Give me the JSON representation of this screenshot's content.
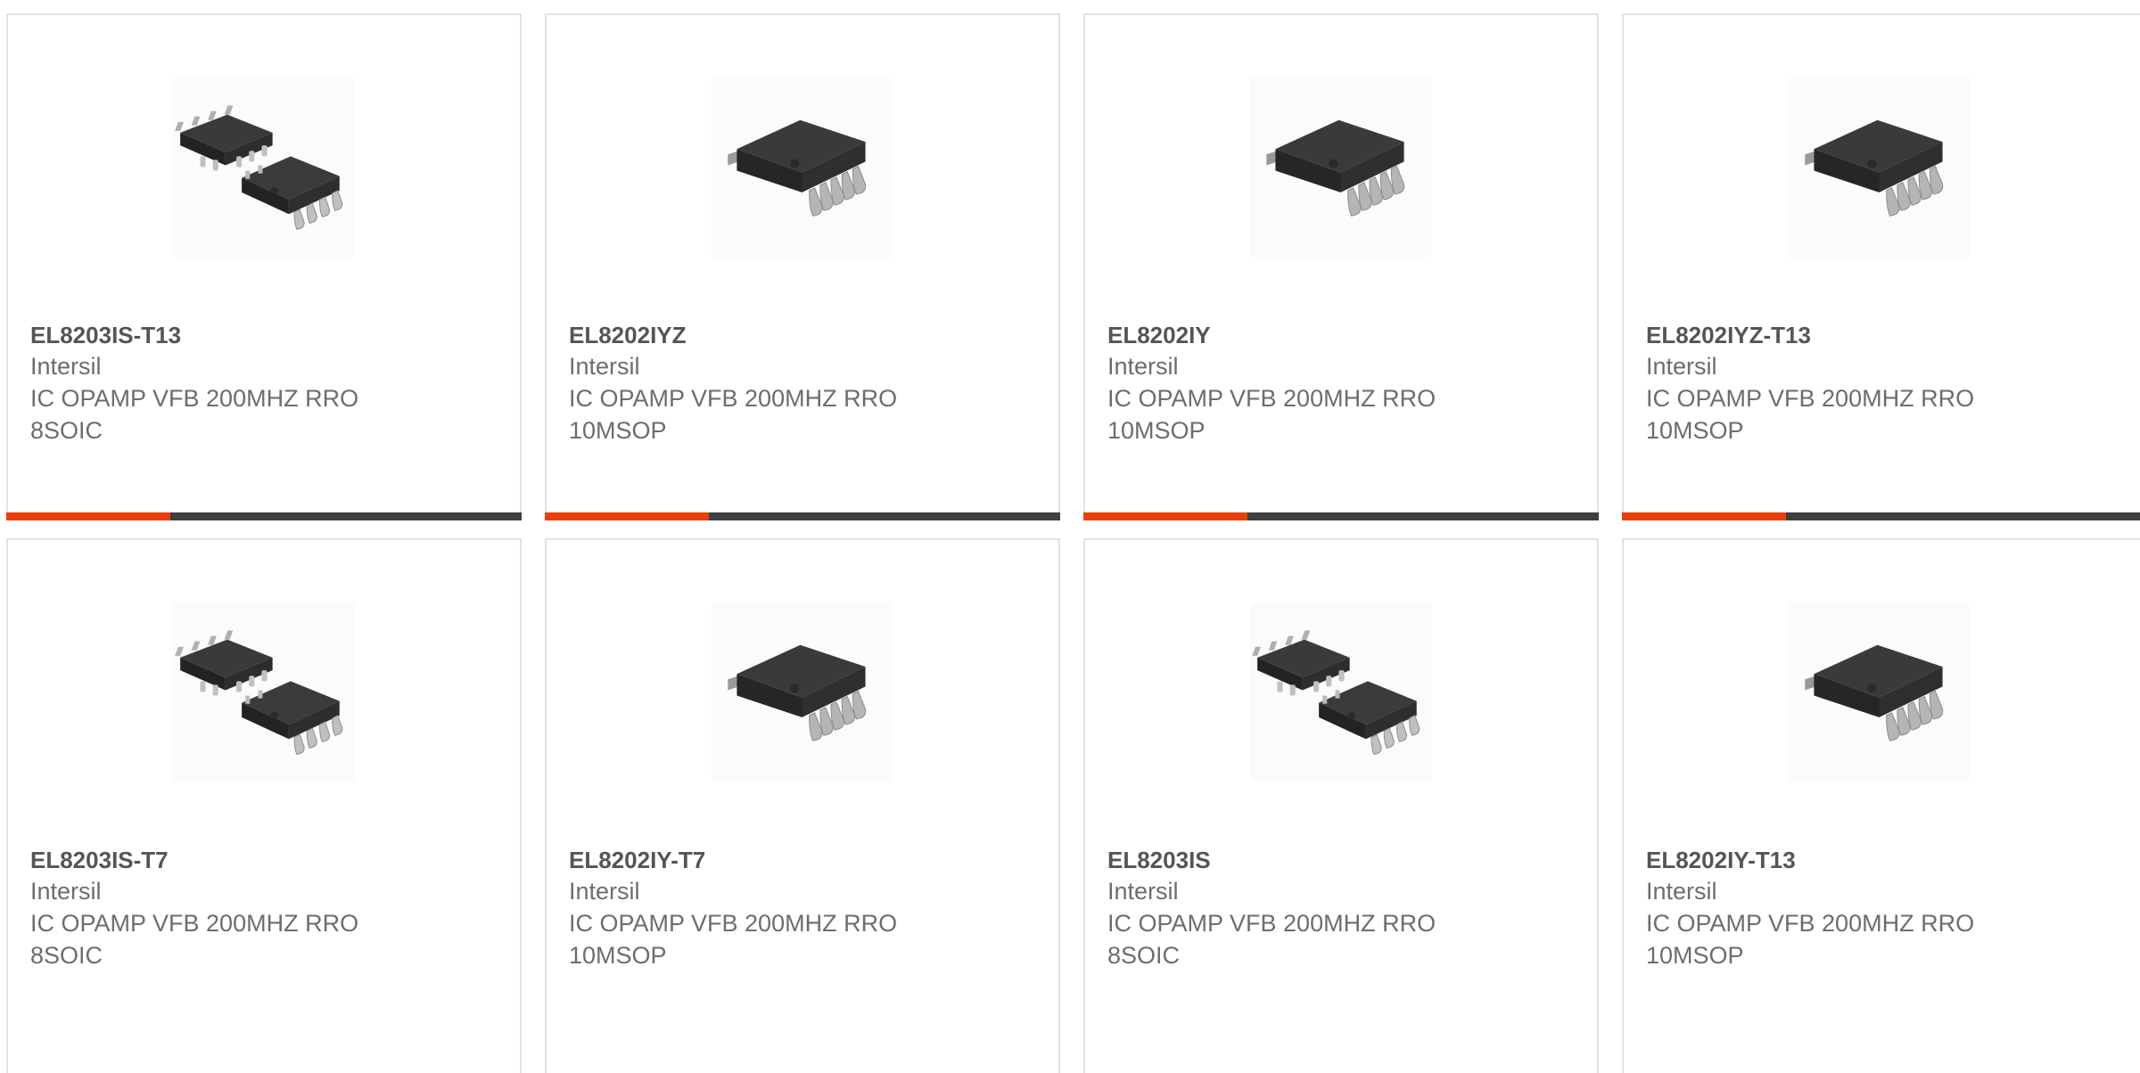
{
  "accent_color": "#e8400c",
  "bar_color": "#3f3f3f",
  "products": [
    {
      "part": "EL8203IS-T13",
      "manufacturer": "Intersil",
      "description": "IC OPAMP VFB 200MHZ RRO 8SOIC",
      "desc_line1": "IC OPAMP VFB 200MHZ RRO",
      "desc_line2": "8SOIC",
      "image": "soic-8-pair-icon"
    },
    {
      "part": "EL8202IYZ",
      "manufacturer": "Intersil",
      "description": "IC OPAMP VFB 200MHZ RRO 10MSOP",
      "desc_line1": "IC OPAMP VFB 200MHZ RRO",
      "desc_line2": "10MSOP",
      "image": "msop-10-icon"
    },
    {
      "part": "EL8202IY",
      "manufacturer": "Intersil",
      "description": "IC OPAMP VFB 200MHZ RRO 10MSOP",
      "desc_line1": "IC OPAMP VFB 200MHZ RRO",
      "desc_line2": "10MSOP",
      "image": "msop-10-icon"
    },
    {
      "part": "EL8202IYZ-T13",
      "manufacturer": "Intersil",
      "description": "IC OPAMP VFB 200MHZ RRO 10MSOP",
      "desc_line1": "IC OPAMP VFB 200MHZ RRO",
      "desc_line2": "10MSOP",
      "image": "msop-10-icon"
    },
    {
      "part": "EL8203IS-T7",
      "manufacturer": "Intersil",
      "description": "IC OPAMP VFB 200MHZ RRO 8SOIC",
      "desc_line1": "IC OPAMP VFB 200MHZ RRO",
      "desc_line2": "8SOIC",
      "image": "soic-8-pair-icon"
    },
    {
      "part": "EL8202IY-T7",
      "manufacturer": "Intersil",
      "description": "IC OPAMP VFB 200MHZ RRO 10MSOP",
      "desc_line1": "IC OPAMP VFB 200MHZ RRO",
      "desc_line2": "10MSOP",
      "image": "msop-10-icon"
    },
    {
      "part": "EL8203IS",
      "manufacturer": "Intersil",
      "description": "IC OPAMP VFB 200MHZ RRO 8SOIC",
      "desc_line1": "IC OPAMP VFB 200MHZ RRO",
      "desc_line2": "8SOIC",
      "image": "soic-8-pair-icon"
    },
    {
      "part": "EL8202IY-T13",
      "manufacturer": "Intersil",
      "description": "IC OPAMP VFB 200MHZ RRO 10MSOP",
      "desc_line1": "IC OPAMP VFB 200MHZ RRO",
      "desc_line2": "10MSOP",
      "image": "msop-10-icon"
    }
  ]
}
